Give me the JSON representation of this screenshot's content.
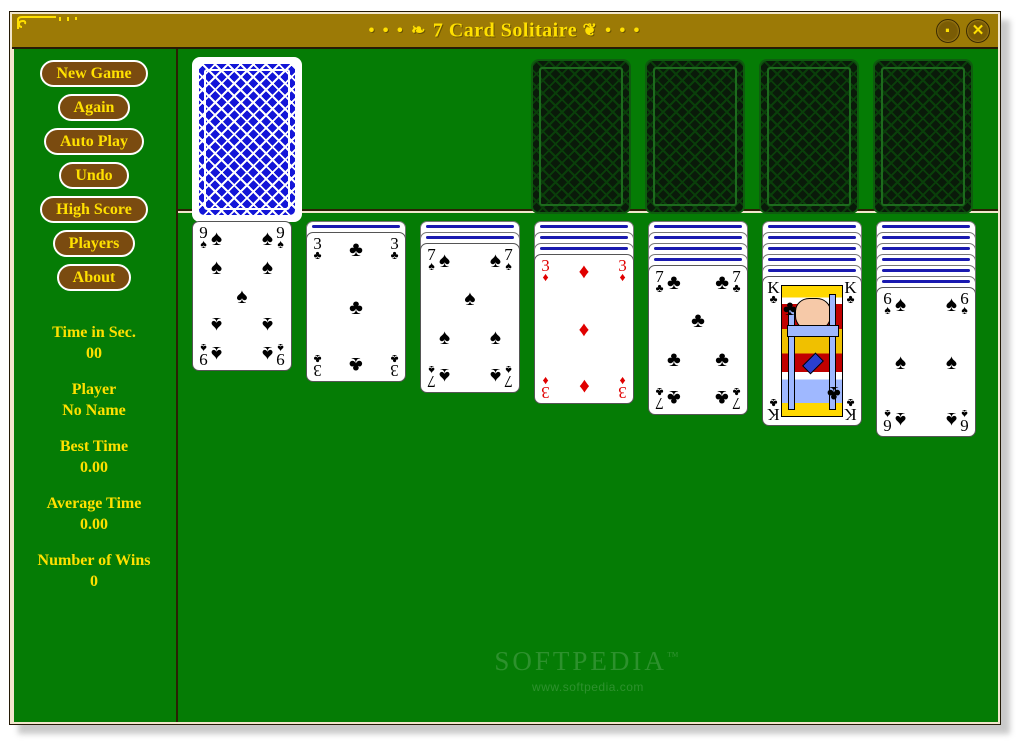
{
  "window": {
    "title": "7 Card Solitaire",
    "title_ornament_left": "• • • ❧",
    "title_ornament_right": "❦ • • •",
    "minimize_label": "·",
    "close_label": "✕",
    "table_color": "#057c05",
    "titlebar_color": "#9c7a06",
    "accent_text_color": "#ffe000"
  },
  "sidebar": {
    "buttons": [
      {
        "label": "New Game",
        "name": "new-game-button"
      },
      {
        "label": "Again",
        "name": "again-button"
      },
      {
        "label": "Auto Play",
        "name": "auto-play-button"
      },
      {
        "label": "Undo",
        "name": "undo-button"
      },
      {
        "label": "High Score",
        "name": "high-score-button"
      },
      {
        "label": "Players",
        "name": "players-button"
      },
      {
        "label": "About",
        "name": "about-button"
      }
    ],
    "stats": [
      {
        "label": "Time in Sec.",
        "value": "00"
      },
      {
        "label": "Player",
        "value": "No Name"
      },
      {
        "label": "Best Time",
        "value": "0.00"
      },
      {
        "label": "Average Time",
        "value": "0.00"
      },
      {
        "label": "Number of Wins",
        "value": "0"
      }
    ]
  },
  "game": {
    "stock": {
      "face_down": true,
      "count_label": ""
    },
    "foundations": [
      {
        "name": "foundation-1",
        "empty": true
      },
      {
        "name": "foundation-2",
        "empty": true
      },
      {
        "name": "foundation-3",
        "empty": true
      },
      {
        "name": "foundation-4",
        "empty": true
      }
    ],
    "tableau": [
      {
        "name": "tableau-pile-1",
        "face_down": 0,
        "rank": "9",
        "suit": "spades",
        "suit_symbol": "♠",
        "color": "black",
        "pip_count": 9
      },
      {
        "name": "tableau-pile-2",
        "face_down": 1,
        "rank": "3",
        "suit": "clubs",
        "suit_symbol": "♣",
        "color": "black",
        "pip_count": 3
      },
      {
        "name": "tableau-pile-3",
        "face_down": 2,
        "rank": "7",
        "suit": "spades",
        "suit_symbol": "♠",
        "color": "black",
        "pip_count": 7
      },
      {
        "name": "tableau-pile-4",
        "face_down": 3,
        "rank": "3",
        "suit": "diamonds",
        "suit_symbol": "♦",
        "color": "red",
        "pip_count": 3
      },
      {
        "name": "tableau-pile-5",
        "face_down": 4,
        "rank": "7",
        "suit": "clubs",
        "suit_symbol": "♣",
        "color": "black",
        "pip_count": 7
      },
      {
        "name": "tableau-pile-6",
        "face_down": 5,
        "rank": "K",
        "suit": "clubs",
        "suit_symbol": "♣",
        "color": "black",
        "pip_count": 0
      },
      {
        "name": "tableau-pile-7",
        "face_down": 6,
        "rank": "6",
        "suit": "spades",
        "suit_symbol": "♠",
        "color": "black",
        "pip_count": 6
      }
    ]
  },
  "watermark": {
    "main": "SOFTPEDIA",
    "tm": "™",
    "sub": "www.softpedia.com"
  }
}
